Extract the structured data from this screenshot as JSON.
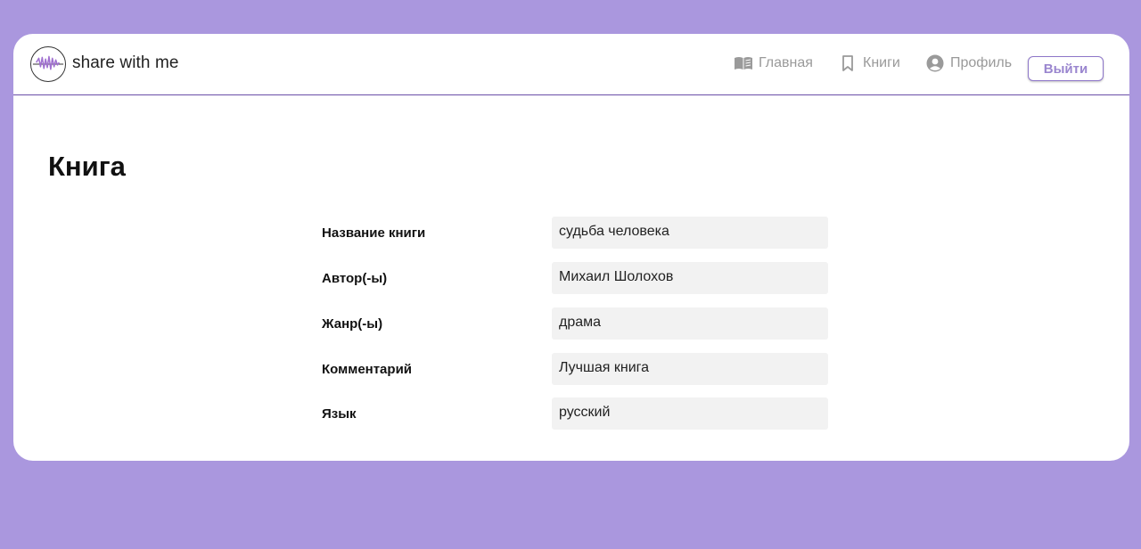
{
  "app": {
    "brand": "share with me"
  },
  "nav": {
    "home_label": "Главная",
    "books_label": "Книги",
    "profile_label": "Профиль",
    "logout_label": "Выйти"
  },
  "page": {
    "title": "Книга"
  },
  "book": {
    "fields": [
      {
        "label": "Название книги",
        "value": "судьба человека"
      },
      {
        "label": "Автор(-ы)",
        "value": "Михаил Шолохов"
      },
      {
        "label": "Жанр(-ы)",
        "value": "драма"
      },
      {
        "label": "Комментарий",
        "value": "Лучшая книга"
      },
      {
        "label": "Язык",
        "value": "русский"
      }
    ]
  },
  "colors": {
    "background": "#aa97de",
    "accent": "#8e77c9",
    "header_border": "#6a4fa8",
    "field_bg": "#f2f2f2",
    "nav_text": "#9a9a9a"
  },
  "icons": {
    "logo": "soundwave-logo-icon",
    "home": "open-book-icon",
    "books": "bookmark-icon",
    "profile": "user-circle-icon"
  }
}
